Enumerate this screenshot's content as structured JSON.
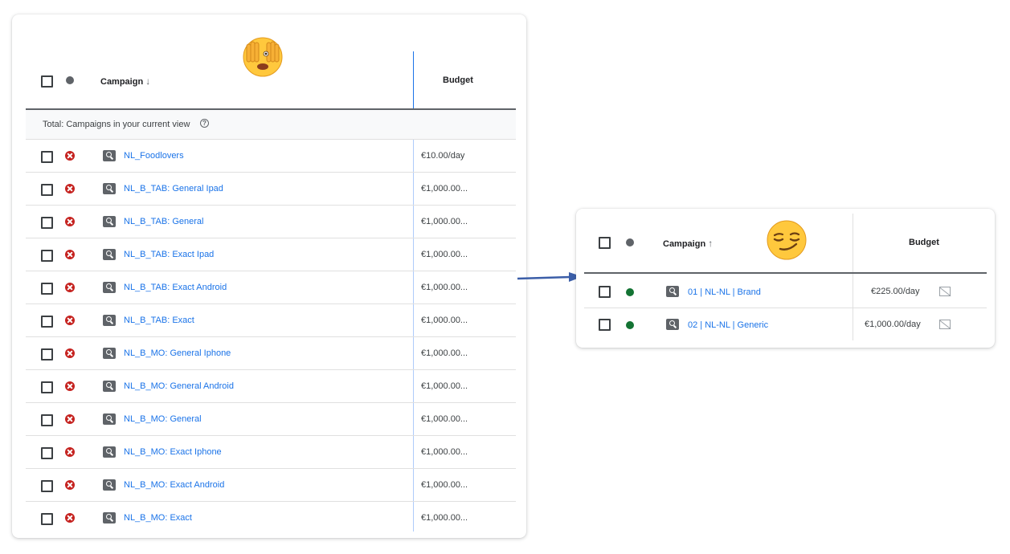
{
  "left_table": {
    "header": {
      "campaign": "Campaign",
      "sort_glyph": "↓",
      "budget": "Budget"
    },
    "total_label": "Total: Campaigns in your current view",
    "help_glyph": "?",
    "rows": [
      {
        "name": "NL_Foodlovers",
        "budget": "€10.00/day"
      },
      {
        "name": "NL_B_TAB: General Ipad",
        "budget": "€1,000.00..."
      },
      {
        "name": "NL_B_TAB: General",
        "budget": "€1,000.00..."
      },
      {
        "name": "NL_B_TAB: Exact Ipad",
        "budget": "€1,000.00..."
      },
      {
        "name": "NL_B_TAB: Exact Android",
        "budget": "€1,000.00..."
      },
      {
        "name": "NL_B_TAB: Exact",
        "budget": "€1,000.00..."
      },
      {
        "name": "NL_B_MO: General Iphone",
        "budget": "€1,000.00..."
      },
      {
        "name": "NL_B_MO: General Android",
        "budget": "€1,000.00..."
      },
      {
        "name": "NL_B_MO: General",
        "budget": "€1,000.00..."
      },
      {
        "name": "NL_B_MO: Exact Iphone",
        "budget": "€1,000.00..."
      },
      {
        "name": "NL_B_MO: Exact Android",
        "budget": "€1,000.00..."
      },
      {
        "name": "NL_B_MO: Exact",
        "budget": "€1,000.00..."
      }
    ],
    "status": "removed"
  },
  "right_table": {
    "header": {
      "campaign": "Campaign",
      "sort_glyph": "↑",
      "budget": "Budget"
    },
    "rows": [
      {
        "name": "01 | NL-NL | Brand",
        "budget": "€225.00/day"
      },
      {
        "name": "02 | NL-NL | Generic",
        "budget": "€1,000.00/day"
      }
    ],
    "status": "enabled"
  },
  "icons": {
    "emoji_left": "face-with-hands-covering-eyes",
    "emoji_right": "smirking-face",
    "campaign_type": "search-icon",
    "status_removed": "removed-x-icon",
    "status_enabled": "green-dot-icon",
    "budget_chart": "budget-chart-icon"
  },
  "colors": {
    "link": "#1a73e8",
    "removed": "#c5221f",
    "enabled": "#137333",
    "arrow": "#3b5ea8",
    "header_divider": "#5f6368",
    "column_divider_left": "#1a73e8"
  }
}
